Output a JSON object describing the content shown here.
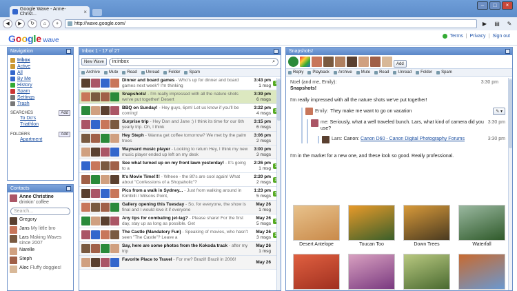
{
  "browser": {
    "tab_title": "Google Wave - Anne-Christ...",
    "url": "http://wave.google.com/"
  },
  "header": {
    "logo_google": "Google",
    "logo_wave": "wave",
    "links": [
      "Terms",
      "Privacy",
      "Sign out"
    ],
    "sep": "|"
  },
  "navigation": {
    "title": "Navigation",
    "items": [
      {
        "label": "Inbox",
        "color": "#c93"
      },
      {
        "label": "Active",
        "color": "#c93"
      },
      {
        "label": "All",
        "color": "#36c"
      },
      {
        "label": "By Me",
        "color": "#36c"
      },
      {
        "label": "History",
        "color": "#3a3"
      },
      {
        "label": "Spam",
        "color": "#c33"
      },
      {
        "label": "Settings",
        "color": "#777"
      },
      {
        "label": "Trash",
        "color": "#777"
      }
    ],
    "searches_label": "SEARCHES",
    "searches_add": "Add",
    "searches": [
      "To Do's",
      "Triathlon"
    ],
    "folders_label": "FOLDERS",
    "folders_add": "Add",
    "folders": [
      "Apartment"
    ]
  },
  "contacts": {
    "title": "Contacts",
    "me_name": "Anne Christine",
    "me_status": "drinkin' coffee",
    "search_placeholder": "Search...",
    "list": [
      {
        "name": "Gregory",
        "status": ""
      },
      {
        "name": "Jans",
        "status": "My little bro"
      },
      {
        "name": "Lars",
        "status": "Making Waves since 2007"
      },
      {
        "name": "Narelle",
        "status": ""
      },
      {
        "name": "Steph",
        "status": ""
      },
      {
        "name": "Alec",
        "status": "Fluffy doggies!"
      }
    ]
  },
  "inbox": {
    "title": "Inbox 1 - 17 of 27",
    "new_wave": "New Wave",
    "search_value": "in:inbox",
    "actions": [
      "Archive",
      "Mute",
      "Read",
      "Unread",
      "Folder",
      "Spam"
    ],
    "rows": [
      {
        "title": "Dinner and board games",
        "snippet": " - Who's up for dinner and board games next week? I'm thinking",
        "time": "3:43 pm",
        "count": "1 msg",
        "badge": "1",
        "state": "unread"
      },
      {
        "title": "Snapshots!",
        "snippet": " - I'm really impressed with all the nature shots we've put together! Desert",
        "time": "3:39 pm",
        "count": "6 msgs",
        "badge": "",
        "state": "sel"
      },
      {
        "title": "BBQ on Sunday!",
        "snippet": " - Hey guys, 6pm! Let us know if you'll be coming!",
        "time": "3:22 pm",
        "count": "4 msgs",
        "badge": "2",
        "state": "unread"
      },
      {
        "title": "Surprise trip",
        "snippet": " - Hey Dan and Jane :) I think its time for our 6th yearly trip. Oh, I think",
        "time": "3:15 pm",
        "count": "6 msgs",
        "badge": "",
        "state": "read"
      },
      {
        "title": "Hey Steph",
        "snippet": " - Wanna get coffee tomorrow? We met by the palm trees",
        "time": "3:06 pm",
        "count": "2 msgs",
        "badge": "",
        "state": "read"
      },
      {
        "title": "Wayward music player",
        "snippet": " - Looking to return Hey, I think my new music player ended up left on my desk",
        "time": "3:00 pm",
        "count": "3 msgs",
        "badge": "",
        "state": "read"
      },
      {
        "title": "See what turned up on my front lawn yesterday!",
        "snippet": " - It's going to a",
        "time": "2:26 pm",
        "count": "1 msg",
        "badge": "1",
        "state": "unread"
      },
      {
        "title": "It's Movie Time!!!!",
        "snippet": " - Wheee - the 80's are cool again! What about \"Confessions of a Shopaholic\"?",
        "time": "2:20 pm",
        "count": "2 msgs",
        "badge": "2",
        "state": "unread"
      },
      {
        "title": "Pics from a walk in Sydney...",
        "snippet": " - Just from walking around in Kirribilli / Milsons Point,",
        "time": "1:23 pm",
        "count": "5 msgs",
        "badge": "5",
        "state": "unread"
      },
      {
        "title": "Gallery opening this Tuesday",
        "snippet": " - So, for everyone, the show is final and I would love it if everyone",
        "time": "May 26",
        "count": "1 msg",
        "badge": "",
        "state": "read"
      },
      {
        "title": "Any tips for combating jet-lag?",
        "snippet": " - Please share! For the first day, stay up as long as possible. Get",
        "time": "May 26",
        "count": "5 msgs",
        "badge": "1",
        "state": "unread"
      },
      {
        "title": "The Castle (Mandatory Fun)",
        "snippet": " - Speaking of movies, who hasn't seen \"The Castle\"? Leave a",
        "time": "May 26",
        "count": "3 msgs",
        "badge": "2",
        "state": "unread"
      },
      {
        "title": "Say, here are some photos from the Kokoda track",
        "snippet": " - after my trip",
        "time": "May 26",
        "count": "1 msg",
        "badge": "",
        "state": "read"
      },
      {
        "title": "Favorite Place to Travel",
        "snippet": " - For me? Brazil! Brazil in 2006!",
        "time": "May 26",
        "count": "",
        "badge": "",
        "state": "read"
      }
    ]
  },
  "wave": {
    "title": "Snapshots!",
    "add_label": "Add",
    "actions": [
      "Reply",
      "Playback",
      "Archive",
      "Mute",
      "Read",
      "Unread",
      "Folder",
      "Spam"
    ],
    "root_header": "Noel (and me, Emily):",
    "root_time": "3:30 pm",
    "root_title": "Snapshots!",
    "root_text": "I'm really impressed with all the nature shots we've put together!",
    "r1_name": "Emily:",
    "r1_text": "They make me want to go on vacation",
    "r2_name": "me:",
    "r2_text": "Seriously, what a well traveled bunch. Lars, what kind of camera did you use?",
    "r2_time": "3:30 pm",
    "r3_name": "Lars:",
    "r3_prefix": "Canon:",
    "r3_link": "Canon D60 - Canon Digital Photography Forums",
    "r3_time": "3:30 pm",
    "root_text2": "I'm in the market for a new one, and these look so good. Really professional.",
    "photos": [
      {
        "caption": "Desert Antelope",
        "c1": "#c98a4a",
        "c2": "#e8c28c"
      },
      {
        "caption": "Toucan Too",
        "c1": "#3b5f2a",
        "c2": "#e89a2a"
      },
      {
        "caption": "Down Trees",
        "c1": "#4a3a20",
        "c2": "#d89a3a"
      },
      {
        "caption": "Waterfall",
        "c1": "#2f5a2a",
        "c2": "#9ab8a0"
      },
      {
        "caption": "",
        "c1": "#a03020",
        "c2": "#e06040"
      },
      {
        "caption": "",
        "c1": "#7a3a80",
        "c2": "#d8a0c0"
      },
      {
        "caption": "",
        "c1": "#4a6a30",
        "c2": "#b8c880"
      },
      {
        "caption": "",
        "c1": "#6a98d0",
        "c2": "#c86a30"
      }
    ]
  }
}
